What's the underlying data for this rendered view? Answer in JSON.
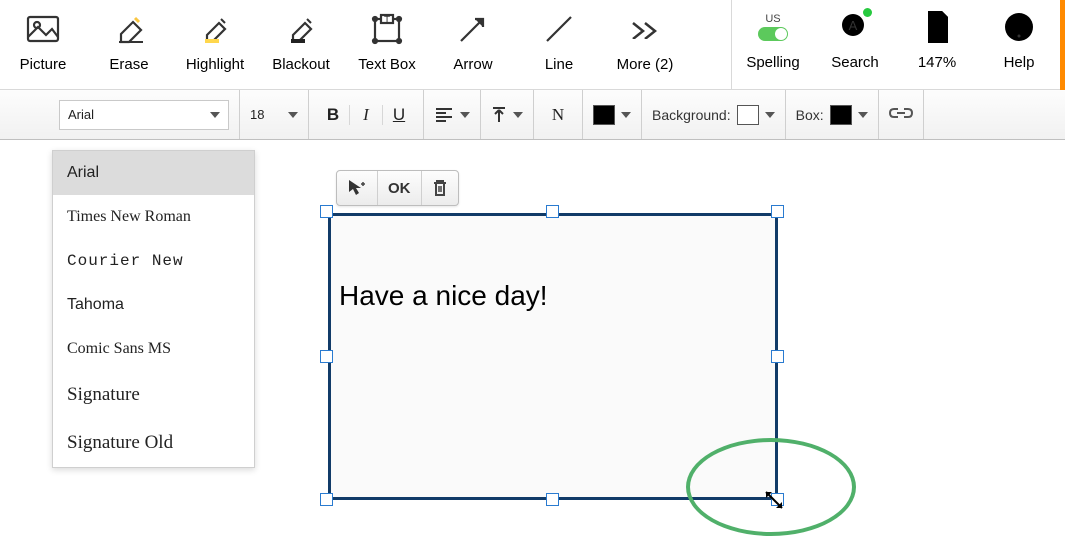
{
  "toolbar": {
    "picture": "Picture",
    "erase": "Erase",
    "highlight": "Highlight",
    "blackout": "Blackout",
    "textbox": "Text Box",
    "arrow": "Arrow",
    "line": "Line",
    "more": "More (2)",
    "spelling": "Spelling",
    "spelling_lang": "US",
    "search": "Search",
    "zoom": "147%",
    "help": "Help"
  },
  "format": {
    "font": "Arial",
    "size": "18",
    "bold": "B",
    "italic": "I",
    "underline": "U",
    "normal": "N",
    "background_label": "Background:",
    "box_label": "Box:"
  },
  "font_options": [
    "Arial",
    "Times New Roman",
    "Courier New",
    "Tahoma",
    "Comic Sans MS",
    "Signature",
    "Signature Old"
  ],
  "float_toolbar": {
    "ok": "OK"
  },
  "textbox": {
    "content": "Have a nice day!"
  },
  "colors": {
    "selection_border": "#113b68",
    "handle_border": "#2a7bd0",
    "annotation": "#50b06a",
    "toggle_on": "#5cc95c"
  }
}
